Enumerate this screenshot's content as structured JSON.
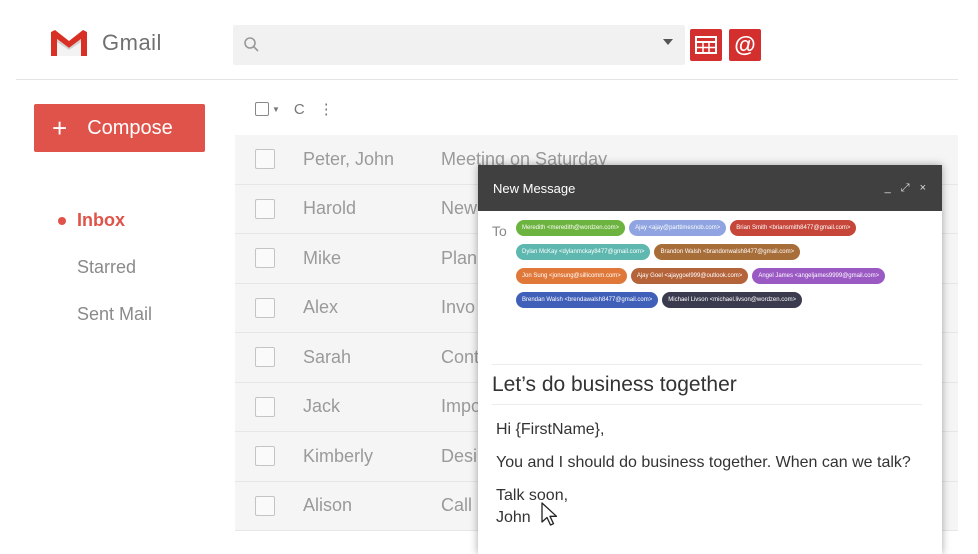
{
  "header": {
    "app_name": "Gmail",
    "search": {
      "placeholder": "",
      "value": ""
    },
    "extensions": [
      {
        "icon": "table-icon"
      },
      {
        "icon": "at-icon",
        "label": "@"
      }
    ]
  },
  "sidebar": {
    "compose_label": "Compose",
    "items": [
      {
        "label": "Inbox",
        "active": true
      },
      {
        "label": "Starred"
      },
      {
        "label": "Sent Mail"
      }
    ]
  },
  "toolbar": {
    "refresh_icon": "C",
    "more_icon": "⋮"
  },
  "emails": [
    {
      "sender": "Peter, John",
      "subject": "Meeting on Saturday"
    },
    {
      "sender": "Harold",
      "subject": "New"
    },
    {
      "sender": "Mike",
      "subject": "Plan"
    },
    {
      "sender": "Alex",
      "subject": "Invo"
    },
    {
      "sender": "Sarah",
      "subject": "Cont"
    },
    {
      "sender": "Jack",
      "subject": "Impo"
    },
    {
      "sender": "Kimberly",
      "subject": "Desi"
    },
    {
      "sender": "Alison",
      "subject": "Call"
    }
  ],
  "compose_window": {
    "title": "New Message",
    "to_label": "To",
    "recipients": [
      {
        "text": "Meredith <meredith@wordzen.com>",
        "color": "#6db33f"
      },
      {
        "text": "Ajay <ajay@parttimesnob.com>",
        "color": "#8fa4e0"
      },
      {
        "text": "Brian Smith <briansmith8477@gmail.com>",
        "color": "#c6463a"
      },
      {
        "text": "Dylan McKay <dylanmckay8477@gmail.com>",
        "color": "#5eb8b0"
      },
      {
        "text": "Brandon Walsh <brandonwalsh8477@gmail.com>",
        "color": "#a86e3a"
      },
      {
        "text": "Jon Sung <jonsung@sillicomm.com>",
        "color": "#e0783a"
      },
      {
        "text": "Ajay Goel <ajaygoel999@outlook.com>",
        "color": "#b5643a"
      },
      {
        "text": "Angel James <angeljames9999@gmail.com>",
        "color": "#9b59c4"
      },
      {
        "text": "Brendan Walsh <brendawalsh8477@gmail.com>",
        "color": "#3f5fb8"
      },
      {
        "text": "Michael Livson <michael.livson@wordzen.com>",
        "color": "#3b3b4f"
      }
    ],
    "subject": "Let’s do business together",
    "body": {
      "greeting": "Hi {FirstName},",
      "line1": "You and I should do business together. When can we talk?",
      "signoff": "Talk soon,",
      "signature": "John"
    },
    "controls": {
      "minimize": "_",
      "expand": "⤢",
      "close": "×"
    }
  },
  "colors": {
    "accent": "#e0534a",
    "extension": "#d32f2f",
    "compose_header": "#404040"
  }
}
